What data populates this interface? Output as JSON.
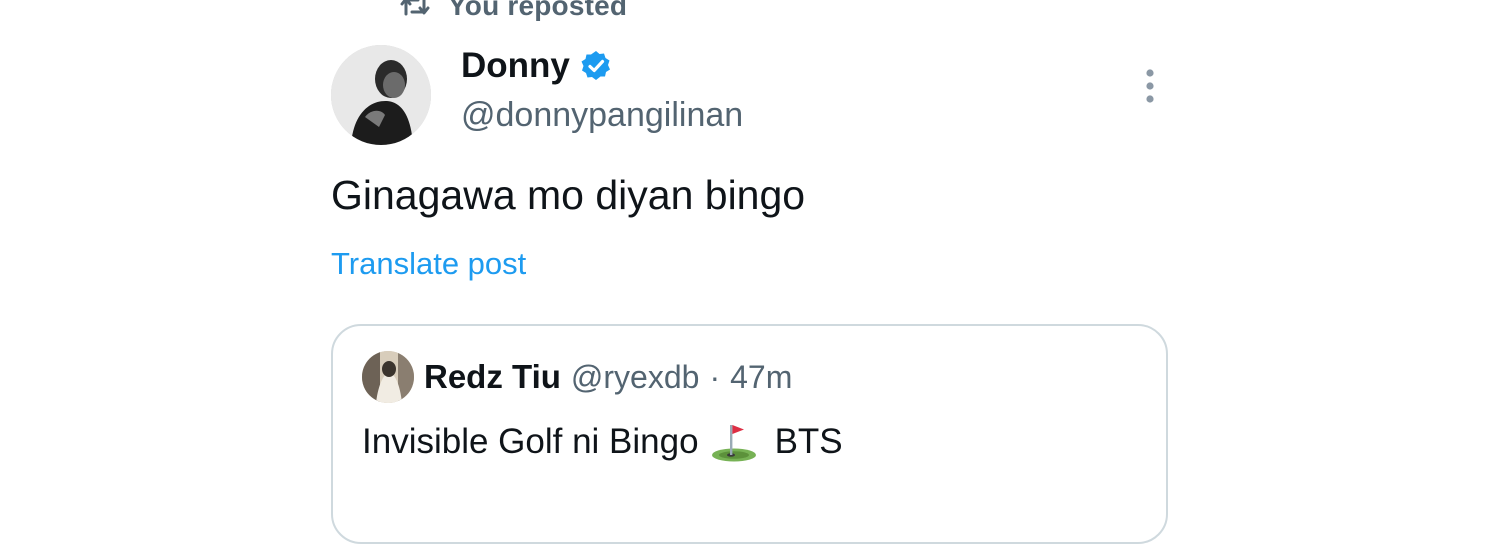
{
  "repost_banner": {
    "label": "You reposted",
    "icon": "repost-icon"
  },
  "post": {
    "author": {
      "name": "Donny",
      "handle": "@donnypangilinan",
      "verified": true,
      "avatar_icon": "user-avatar"
    },
    "text": "Ginagawa mo diyan bingo",
    "translate_label": "Translate post",
    "more_icon": "more-vertical-icon"
  },
  "quoted_post": {
    "author": {
      "name": "Redz Tiu",
      "handle": "@ryexdb",
      "avatar_icon": "user-avatar"
    },
    "separator": "·",
    "timestamp": "47m",
    "text_before": "Invisible Golf ni Bingo",
    "emoji_icon": "golf-flag-icon",
    "text_after": "BTS"
  },
  "colors": {
    "accent": "#1d9bf0",
    "secondary_text": "#536471",
    "primary_text": "#0f1419",
    "border": "#cfd9de"
  }
}
